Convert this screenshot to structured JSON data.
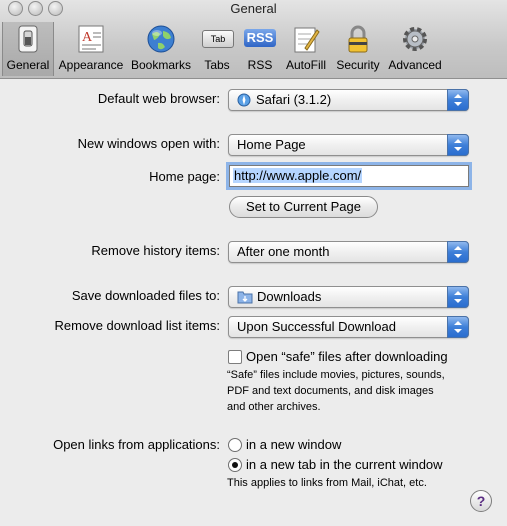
{
  "window": {
    "title": "General"
  },
  "toolbar": {
    "items": [
      {
        "label": "General",
        "icon": "switch-icon"
      },
      {
        "label": "Appearance",
        "icon": "appearance-icon"
      },
      {
        "label": "Bookmarks",
        "icon": "globe-icon"
      },
      {
        "label": "Tabs",
        "icon": "tab-icon",
        "icon_text": "Tab"
      },
      {
        "label": "RSS",
        "icon": "rss-icon",
        "icon_text": "RSS"
      },
      {
        "label": "AutoFill",
        "icon": "pencil-pad-icon"
      },
      {
        "label": "Security",
        "icon": "padlock-icon"
      },
      {
        "label": "Advanced",
        "icon": "gear-icon"
      }
    ],
    "selected": "General"
  },
  "form": {
    "default_browser": {
      "label": "Default web browser:",
      "value": "Safari (3.1.2)"
    },
    "new_windows": {
      "label": "New windows open with:",
      "value": "Home Page"
    },
    "home_page": {
      "label": "Home page:",
      "value": "http://www.apple.com/"
    },
    "set_current_page": "Set to Current Page",
    "remove_history": {
      "label": "Remove history items:",
      "value": "After one month"
    },
    "save_downloads": {
      "label": "Save downloaded files to:",
      "value": "Downloads"
    },
    "remove_download_list": {
      "label": "Remove download list items:",
      "value": "Upon Successful Download"
    },
    "open_safe": {
      "label": "Open “safe” files after downloading",
      "checked": false
    },
    "safe_note_1": "“Safe” files include movies, pictures, sounds,",
    "safe_note_2": "PDF and text documents, and disk images",
    "safe_note_3": "and other archives.",
    "open_links": {
      "label": "Open links from applications:",
      "options": [
        "in a new window",
        "in a new tab in the current window"
      ],
      "selected": "in a new tab in the current window"
    },
    "links_note": "This applies to links from Mail, iChat, etc.",
    "help": "?"
  },
  "colors": {
    "accent": "#3e7fd8",
    "focus_ring": "#8db4e8",
    "selection": "#b5d5ff"
  }
}
